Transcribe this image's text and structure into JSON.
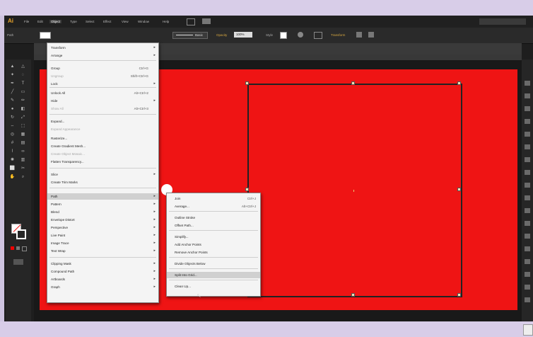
{
  "app": {
    "logo": "Ai"
  },
  "menubar": {
    "items": [
      "File",
      "Edit",
      "Object",
      "Type",
      "Select",
      "Effect",
      "View",
      "Window",
      "Help"
    ],
    "active": "Object"
  },
  "control_bar": {
    "stroke_label": "Basic",
    "opacity_label": "Opacity",
    "opacity_value": "100%",
    "style_label": "Style"
  },
  "object_menu": {
    "items": [
      {
        "label": "Transform",
        "shortcut": "",
        "submenu": true,
        "disabled": false
      },
      {
        "label": "Arrange",
        "shortcut": "",
        "submenu": true,
        "disabled": false
      },
      {
        "label": "Group",
        "shortcut": "Ctrl+G",
        "submenu": false,
        "disabled": false
      },
      {
        "label": "Ungroup",
        "shortcut": "Shift+Ctrl+G",
        "submenu": false,
        "disabled": true
      },
      {
        "label": "Lock",
        "shortcut": "",
        "submenu": true,
        "disabled": false
      },
      {
        "label": "Unlock All",
        "shortcut": "Alt+Ctrl+2",
        "submenu": false,
        "disabled": false
      },
      {
        "label": "Hide",
        "shortcut": "",
        "submenu": true,
        "disabled": false
      },
      {
        "label": "Show All",
        "shortcut": "Alt+Ctrl+3",
        "submenu": false,
        "disabled": true
      },
      {
        "label": "Expand...",
        "shortcut": "",
        "submenu": false,
        "disabled": false
      },
      {
        "label": "Expand Appearance",
        "shortcut": "",
        "submenu": false,
        "disabled": true
      },
      {
        "label": "Rasterize...",
        "shortcut": "",
        "submenu": false,
        "disabled": false
      },
      {
        "label": "Create Gradient Mesh...",
        "shortcut": "",
        "submenu": false,
        "disabled": false
      },
      {
        "label": "Create Object Mosaic...",
        "shortcut": "",
        "submenu": false,
        "disabled": true
      },
      {
        "label": "Flatten Transparency...",
        "shortcut": "",
        "submenu": false,
        "disabled": false
      },
      {
        "label": "Slice",
        "shortcut": "",
        "submenu": true,
        "disabled": false
      },
      {
        "label": "Create Trim Marks",
        "shortcut": "",
        "submenu": false,
        "disabled": false
      },
      {
        "label": "Path",
        "shortcut": "",
        "submenu": true,
        "disabled": false
      },
      {
        "label": "Pattern",
        "shortcut": "",
        "submenu": true,
        "disabled": false
      },
      {
        "label": "Blend",
        "shortcut": "",
        "submenu": true,
        "disabled": false
      },
      {
        "label": "Envelope Distort",
        "shortcut": "",
        "submenu": true,
        "disabled": false
      },
      {
        "label": "Perspective",
        "shortcut": "",
        "submenu": true,
        "disabled": false
      },
      {
        "label": "Live Paint",
        "shortcut": "",
        "submenu": true,
        "disabled": false
      },
      {
        "label": "Image Trace",
        "shortcut": "",
        "submenu": true,
        "disabled": false
      },
      {
        "label": "Text Wrap",
        "shortcut": "",
        "submenu": true,
        "disabled": false
      },
      {
        "label": "Clipping Mask",
        "shortcut": "",
        "submenu": true,
        "disabled": false
      },
      {
        "label": "Compound Path",
        "shortcut": "",
        "submenu": true,
        "disabled": false
      },
      {
        "label": "Artboards",
        "shortcut": "",
        "submenu": true,
        "disabled": false
      },
      {
        "label": "Graph",
        "shortcut": "",
        "submenu": true,
        "disabled": false
      }
    ]
  },
  "path_submenu": {
    "items": [
      {
        "label": "Join",
        "shortcut": "Ctrl+J",
        "disabled": false
      },
      {
        "label": "Average...",
        "shortcut": "Alt+Ctrl+J",
        "disabled": false
      },
      {
        "label": "Outline Stroke",
        "shortcut": "",
        "disabled": false
      },
      {
        "label": "Offset Path...",
        "shortcut": "",
        "disabled": false
      },
      {
        "label": "Simplify...",
        "shortcut": "",
        "disabled": false
      },
      {
        "label": "Add Anchor Points",
        "shortcut": "",
        "disabled": false
      },
      {
        "label": "Remove Anchor Points",
        "shortcut": "",
        "disabled": false
      },
      {
        "label": "Divide Objects Below",
        "shortcut": "",
        "disabled": false
      },
      {
        "label": "Split Into Grid...",
        "shortcut": "",
        "disabled": false
      },
      {
        "label": "Clean Up...",
        "shortcut": "",
        "disabled": false
      }
    ]
  },
  "colors": {
    "artboard": "#ef1414",
    "canvas": "#191919",
    "menu_bg": "#f4f4f4",
    "logo": "#e8a42b"
  }
}
